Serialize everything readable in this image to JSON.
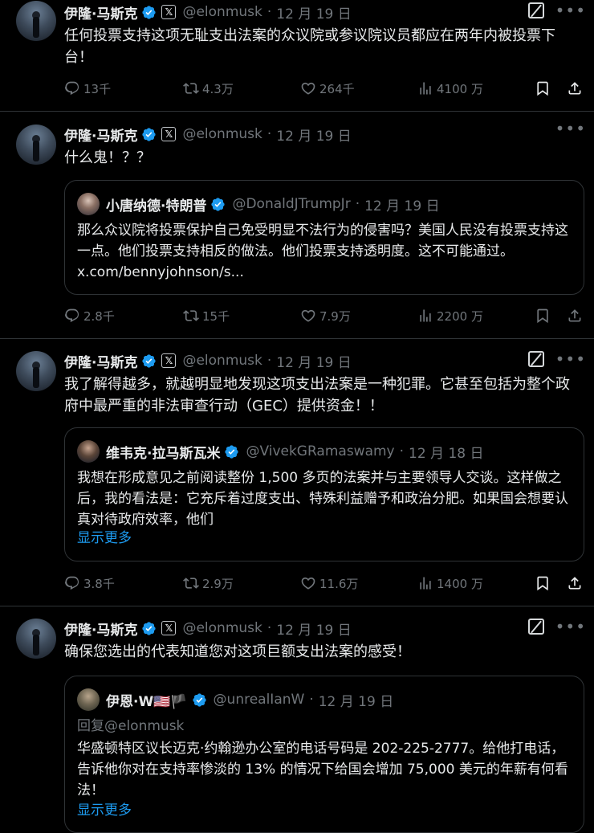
{
  "colors": {
    "background": "#000000",
    "text": "#e7e9ea",
    "muted": "#71767b",
    "link": "#1d9bf0",
    "verified": "#1d9bf0",
    "border": "#2f3336"
  },
  "tweets": [
    {
      "name": "伊隆·马斯克",
      "handle": "@elonmusk",
      "date": "12 月 19 日",
      "text": "任何投票支持这项无耻支出法案的众议院或参议院议员都应在两年内被投票下台！",
      "replies": "13千",
      "reposts": "4.3万",
      "likes": "264千",
      "views": "4100 万",
      "icons": [
        "verified-badge-icon",
        "x-badge-icon",
        "grok-icon",
        "more-icon",
        "reply-icon",
        "repost-icon",
        "like-icon",
        "views-icon",
        "bookmark-icon",
        "share-icon"
      ]
    },
    {
      "name": "伊隆·马斯克",
      "handle": "@elonmusk",
      "date": "12 月 19 日",
      "text": "什么鬼！？？",
      "quote": {
        "name": "小唐纳德·特朗普",
        "handle": "@DonaldJTrumpJr",
        "date": "12 月 19 日",
        "text": "那么众议院将投票保护自己免受明显不法行为的侵害吗？美国人民没有投票支持这一点。他们投票支持相反的做法。他们投票支持透明度。这不可能通过。x.com/bennyjohnson/s..."
      },
      "replies": "2.8千",
      "reposts": "15千",
      "likes": "7.9万",
      "views": "2200 万"
    },
    {
      "name": "伊隆·马斯克",
      "handle": "@elonmusk",
      "date": "12 月 19 日",
      "text": "我了解得越多，就越明显地发现这项支出法案是一种犯罪。它甚至包括为整个政府中最严重的非法审查行动（GEC）提供资金！！",
      "quote": {
        "name": "维韦克·拉马斯瓦米",
        "handle": "@VivekGRamaswamy",
        "date": "12 月 18 日",
        "text": "我想在形成意见之前阅读整份 1,500 多页的法案并与主要领导人交谈。这样做之后，我的看法是：它充斥着过度支出、特殊利益赠予和政治分肥。如果国会想要认真对待政府效率，他们",
        "show_more": "显示更多"
      },
      "replies": "3.8千",
      "reposts": "2.9万",
      "likes": "11.6万",
      "views": "1400 万"
    },
    {
      "name": "伊隆·马斯克",
      "handle": "@elonmusk",
      "date": "12 月 19 日",
      "text": "确保您选出的代表知道您对这项巨额支出法案的感受！",
      "quote": {
        "name": "伊恩·W🇺🇸🏴",
        "handle": "@unrealIanW",
        "date": "12 月 19 日",
        "reply_to": "回复@elonmusk",
        "text": "华盛顿特区议长迈克·约翰逊办公室的电话号码是 202-225-2777。给他打电话，告诉他你对在支持率惨淡的 13% 的情况下给国会增加 75,000 美元的年薪有何看法！",
        "show_more": "显示更多"
      }
    }
  ]
}
